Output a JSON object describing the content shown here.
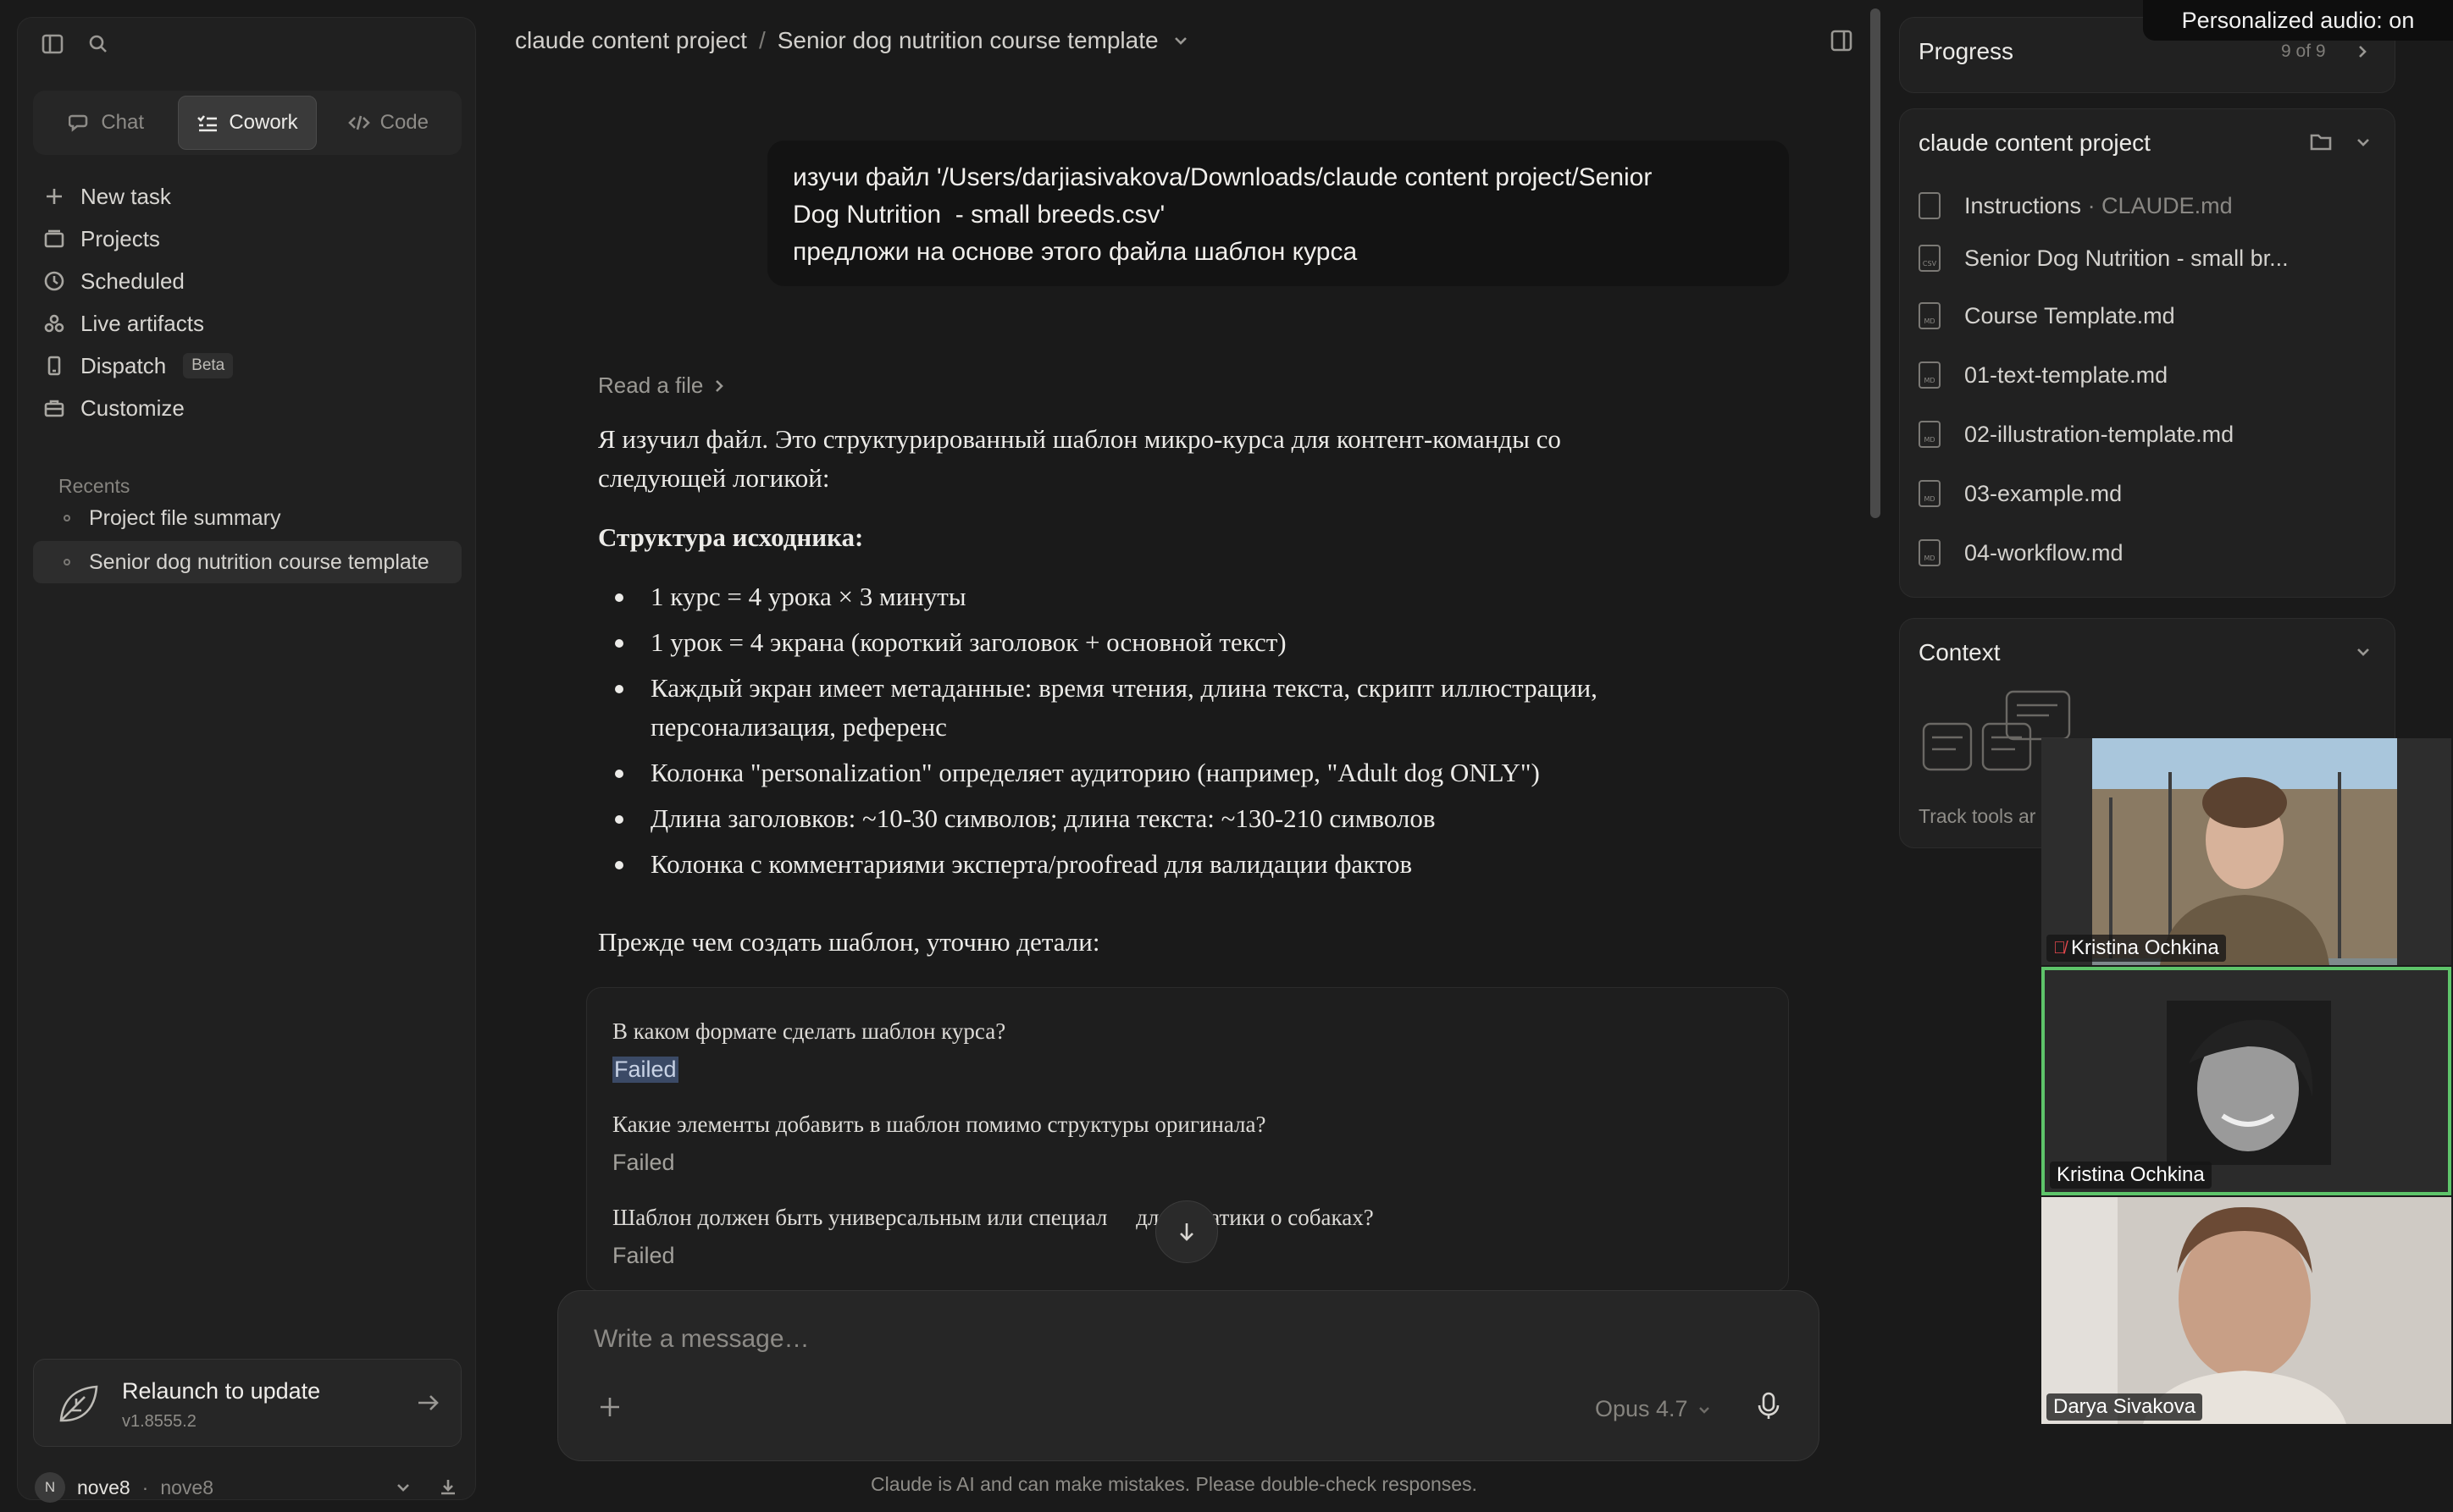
{
  "sidebar": {
    "modes": [
      {
        "label": "Chat",
        "active": false
      },
      {
        "label": "Cowork",
        "active": true
      },
      {
        "label": "Code",
        "active": false
      }
    ],
    "nav": [
      {
        "label": "New task",
        "icon": "plus-icon"
      },
      {
        "label": "Projects",
        "icon": "folder-icon"
      },
      {
        "label": "Scheduled",
        "icon": "clock-icon"
      },
      {
        "label": "Live artifacts",
        "icon": "artifacts-icon"
      },
      {
        "label": "Dispatch",
        "icon": "phone-icon",
        "badge": "Beta"
      },
      {
        "label": "Customize",
        "icon": "briefcase-icon"
      }
    ],
    "recents_label": "Recents",
    "recents": [
      {
        "label": "Project file summary",
        "active": false
      },
      {
        "label": "Senior dog nutrition course template",
        "active": true
      }
    ],
    "relaunch": {
      "title": "Relaunch to update",
      "version": "v1.8555.2"
    },
    "user": {
      "initial": "N",
      "name": "nove8",
      "org": "nove8"
    }
  },
  "header": {
    "project": "claude content project",
    "separator": "/",
    "chat_title": "Senior dog nutrition course template"
  },
  "conversation": {
    "user_message_lines": [
      "изучи файл '/Users/darjiasivakova/Downloads/claude content project/Senior",
      "Dog Nutrition  - small breeds.csv'",
      "предложи на основе этого файла шаблон курса"
    ],
    "tool_step": "Read a file",
    "intro_line1": "Я изучил файл. Это структурированный шаблон микро-курса для контент-команды со",
    "intro_line2": "следующей логикой:",
    "structure_heading": "Структура исходника:",
    "bullets": [
      "1 курс = 4 урока × 3 минуты",
      "1 урок = 4 экрана (короткий заголовок + основной текст)",
      "Каждый экран имеет метаданные: время чтения, длина текста, скрипт иллюстрации, персонализация, референс",
      "Колонка \"personalization\" определяет аудиторию (например, \"Adult dog ONLY\")",
      "Длина заголовков: ~10-30 символов; длина текста: ~130-210 символов",
      "Колонка с комментариями эксперта/proofread для валидации фактов"
    ],
    "clarify": "Прежде чем создать шаблон, уточню детали:",
    "questions": [
      {
        "q": "В каком формате сделать шаблон курса?",
        "a": "Failed"
      },
      {
        "q": "Какие элементы добавить в шаблон помимо структуры оригинала?",
        "a": "Failed"
      },
      {
        "q": "Шаблон должен быть универсальным или специал     для тематики о собаках?",
        "a": "Failed"
      }
    ]
  },
  "composer": {
    "placeholder": "Write a message…",
    "model": "Opus 4.7",
    "disclaimer": "Claude is AI and can make mistakes. Please double-check responses."
  },
  "right_panel": {
    "progress": {
      "title": "Progress",
      "count": "9 of 9"
    },
    "project": {
      "title": "claude content project",
      "files": [
        {
          "name": "Instructions",
          "suffix": " · CLAUDE.md",
          "type": ""
        },
        {
          "name": "Senior Dog Nutrition - small br...",
          "suffix": "",
          "type": "CSV"
        },
        {
          "name": "Course Template.md",
          "suffix": "",
          "type": "MD"
        },
        {
          "name": "01-text-template.md",
          "suffix": "",
          "type": "MD"
        },
        {
          "name": "02-illustration-template.md",
          "suffix": "",
          "type": "MD"
        },
        {
          "name": "03-example.md",
          "suffix": "",
          "type": "MD"
        },
        {
          "name": "04-workflow.md",
          "suffix": "",
          "type": "MD"
        }
      ]
    },
    "context": {
      "title": "Context",
      "track_text": "Track tools ar"
    }
  },
  "video_call": {
    "audio_status": "Personalized audio: on",
    "participants": [
      {
        "name": "Kristina Ochkina",
        "muted": true,
        "speaking": false
      },
      {
        "name": "Kristina Ochkina",
        "muted": false,
        "speaking": true
      },
      {
        "name": "Darya Sivakova",
        "muted": false,
        "speaking": false
      }
    ]
  },
  "colors": {
    "background": "#1a1a1a",
    "sidebar": "#202020",
    "speaking_border": "#5ec46a",
    "selection": "#3b4a66"
  }
}
